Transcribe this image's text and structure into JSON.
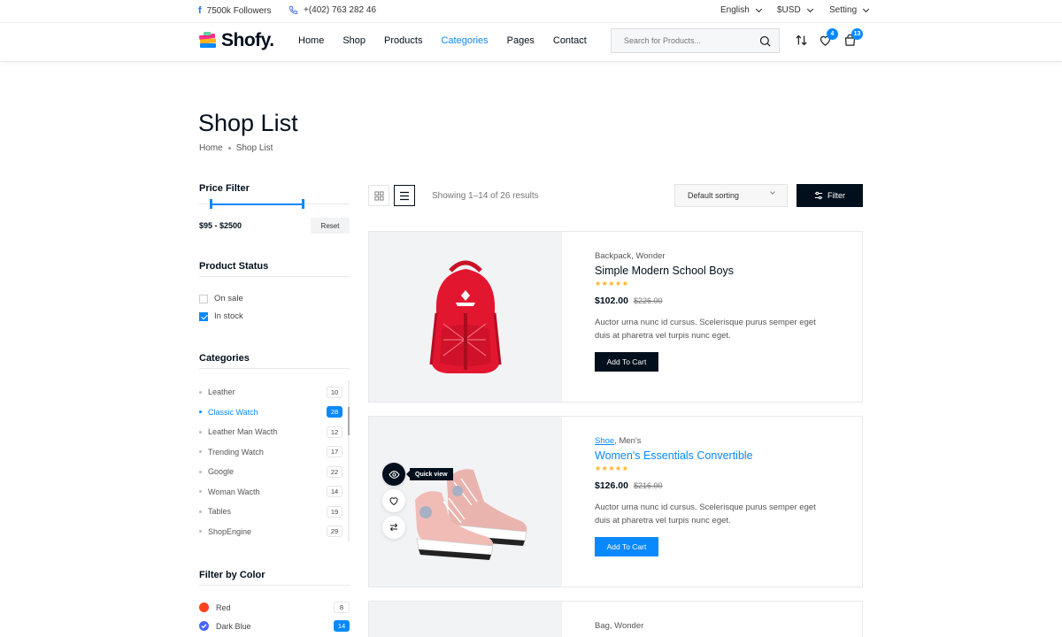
{
  "topbar": {
    "followers": "7500k Followers",
    "phone": "+(402) 763 282 46",
    "language": "English",
    "currency": "$USD",
    "setting": "Setting"
  },
  "header": {
    "logo_text": "Shofy.",
    "nav": [
      "Home",
      "Shop",
      "Products",
      "Categories",
      "Pages",
      "Contact"
    ],
    "active_nav": "Categories",
    "search_placeholder": "Search for Products...",
    "wishlist_count": "4",
    "cart_count": "13"
  },
  "page": {
    "title": "Shop List",
    "breadcrumb": [
      "Home",
      "Shop List"
    ]
  },
  "sidebar": {
    "price_filter": {
      "heading": "Price Filter",
      "value": "$95 - $2500",
      "reset_label": "Reset"
    },
    "product_status": {
      "heading": "Product Status",
      "options": [
        {
          "label": "On sale",
          "checked": false
        },
        {
          "label": "In stock",
          "checked": true
        }
      ]
    },
    "categories": {
      "heading": "Categories",
      "items": [
        {
          "label": "Leather",
          "count": "10",
          "active": false
        },
        {
          "label": "Classic Watch",
          "count": "28",
          "active": true
        },
        {
          "label": "Leather Man Wacth",
          "count": "12",
          "active": false
        },
        {
          "label": "Trending Watch",
          "count": "17",
          "active": false
        },
        {
          "label": "Google",
          "count": "22",
          "active": false
        },
        {
          "label": "Woman Wacth",
          "count": "14",
          "active": false
        },
        {
          "label": "Tables",
          "count": "19",
          "active": false
        },
        {
          "label": "ShopEngine",
          "count": "29",
          "active": false
        }
      ]
    },
    "colors": {
      "heading": "Filter by Color",
      "items": [
        {
          "label": "Red",
          "count": "8",
          "color": "#ff401f",
          "active": false
        },
        {
          "label": "Dark Blue",
          "count": "14",
          "color": "#4666ff",
          "active": true
        }
      ]
    }
  },
  "toolbar": {
    "showing": "Showing 1–14 of 26 results",
    "sort_value": "Default sorting",
    "filter_label": "Filter"
  },
  "products": [
    {
      "cats": "Backpack, Wonder",
      "cat_link": "",
      "title": "Simple Modern School Boys",
      "stars": "★★★★★",
      "price": "$102.00",
      "old_price": "$226.00",
      "desc": "Auctor urna nunc id cursus. Scelerisque purus semper eget duis at pharetra vel turpis nunc eget.",
      "button": "Add To Cart"
    },
    {
      "cats": ", Men's",
      "cat_link": "Shoe",
      "title": "Women's Essentials Convertible",
      "stars": "★★★★★",
      "price": "$126.00",
      "old_price": "$216.00",
      "desc": "Auctor urna nunc id cursus. Scelerisque purus semper eget duis at pharetra vel turpis nunc eget.",
      "button": "Add To Cart",
      "tooltip": "Quick view"
    },
    {
      "cats": "Bag, Wonder"
    }
  ],
  "colors": {
    "accent": "#0989ff",
    "dark": "#010f1c",
    "star": "#ffb21d"
  }
}
